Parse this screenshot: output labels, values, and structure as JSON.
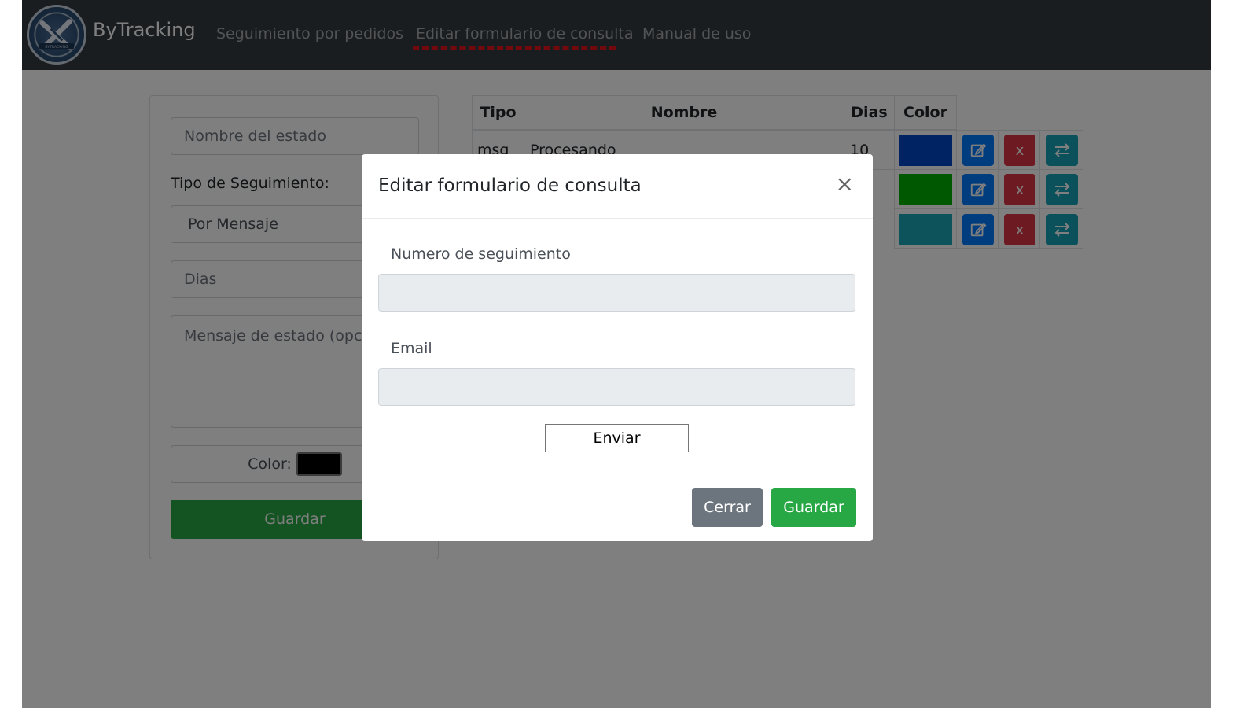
{
  "navbar": {
    "brand": "ByTracking",
    "logo_icon": "bytracking-logo-icon",
    "items": [
      {
        "label": "Seguimiento por pedidos"
      },
      {
        "label": "Editar formulario de consulta"
      },
      {
        "label": "Manual de uso"
      }
    ],
    "active_index": 1,
    "underline_color": "#e8121a"
  },
  "form": {
    "name_placeholder": "Nombre del estado",
    "tipo_label": "Tipo de Seguimiento:",
    "tipo_value": "Por Mensaje",
    "dias_placeholder": "Dias",
    "mensaje_placeholder": "Mensaje de estado (opcional)",
    "color_label": "Color:",
    "color_value": "#000000",
    "guardar_label": "Guardar"
  },
  "table": {
    "headers": [
      "Tipo",
      "Nombre",
      "Dias",
      "Color"
    ],
    "rows": [
      {
        "tipo": "msg",
        "nombre": "Procesando",
        "dias": "10",
        "color": "#0047c8"
      },
      {
        "tipo": "",
        "nombre": "",
        "dias": "",
        "color": "#00b000"
      },
      {
        "tipo": "",
        "nombre": "",
        "dias": "",
        "color": "#1aa6b6"
      }
    ],
    "action_icons": {
      "edit": "edit-icon",
      "delete": "x",
      "swap": "swap-icon"
    }
  },
  "modal": {
    "title": "Editar formulario de consulta",
    "close_symbol": "×",
    "field1_label": "Numero de seguimiento",
    "field2_label": "Email",
    "enviar_label": "Enviar",
    "cerrar_label": "Cerrar",
    "guardar_label": "Guardar"
  }
}
